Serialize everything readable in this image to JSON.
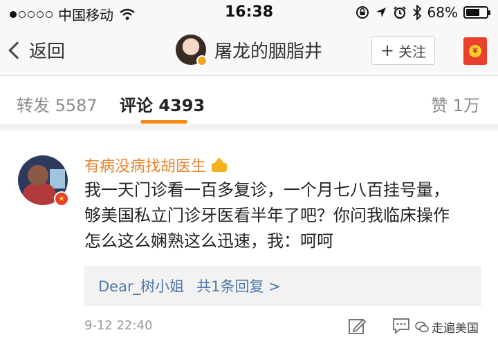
{
  "status_bar": {
    "carrier": "中国移动",
    "time": "16:38",
    "battery": "68%",
    "battery_level": 0.68,
    "icons": [
      "signal-dots",
      "wifi-icon",
      "lock-rotation-icon",
      "location-icon",
      "alarm-icon",
      "bluetooth-icon",
      "battery-icon"
    ]
  },
  "nav": {
    "back_label": "返回",
    "title": "屠龙的胭脂井",
    "follow_label": "关注",
    "gift_icon": "red-envelope-icon"
  },
  "tabs": {
    "repost": "转发 5587",
    "comments": "评论 4393",
    "likes": "赞 1万",
    "active": "comments",
    "accent_color": "#f58b17"
  },
  "comment": {
    "author": "有病没病找胡医生",
    "author_color": "#e8842e",
    "lines": [
      "我一天门诊看一百多复诊，一个月七八百挂号量，",
      "够美国私立门诊牙医看半年了吧？你问我临床操作",
      "怎么这么娴熟这么迅速，我：呵呵"
    ],
    "reply_user": "Dear_树小姐",
    "reply_count": "共1条回复 >",
    "reply_link_color": "#4f79a8",
    "time": "9-12 22:40"
  },
  "watermark": {
    "text": "走遍美国"
  }
}
